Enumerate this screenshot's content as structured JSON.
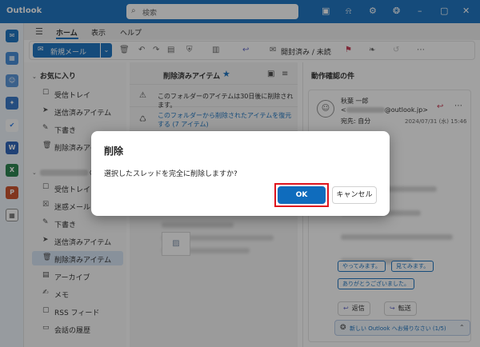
{
  "app": {
    "title": "Outlook"
  },
  "search": {
    "placeholder": "検索"
  },
  "titlebar_icons": [
    "whiteboard-icon",
    "bell-icon",
    "gear-icon",
    "lightbulb-icon",
    "minimize-icon",
    "maximize-icon",
    "close-icon"
  ],
  "menu": {
    "tabs": [
      "ホーム",
      "表示",
      "ヘルプ"
    ],
    "active": "ホーム"
  },
  "ribbon": {
    "new_mail": "新規メール",
    "read_unread": "開封済み / 未読"
  },
  "favorites": {
    "header": "お気に入り",
    "items": [
      "受信トレイ",
      "送信済みアイテム",
      "下書き",
      "削除済みアイテム"
    ]
  },
  "account": {
    "suffix": "@",
    "items": [
      "受信トレイ",
      "迷惑メール",
      "下書き",
      "送信済みアイテム",
      "削除済みアイテム",
      "アーカイブ",
      "メモ",
      "RSS フィード",
      "会話の履歴"
    ],
    "selected": "削除済みアイテム"
  },
  "message_list": {
    "title": "削除済みアイテム",
    "notice": "このフォルダーのアイテムは30日後に削除されます。",
    "restore_link": "このフォルダーから削除されたアイテムを復元する (7 アイテム)"
  },
  "reading_pane": {
    "title": "動作確認の件",
    "sender": "秋葉 一郎",
    "sender_domain": "@outlook.jp>",
    "recipient": "宛先: 自分",
    "date": "2024/07/31 (水) 15:46",
    "quick_replies": [
      "やってみます。",
      "見てみます。",
      "ありがとうございました。"
    ],
    "reply": "返信",
    "forward": "転送",
    "promo": "新しい Outlook へお帰りなさい (1/5)"
  },
  "dialog": {
    "title": "削除",
    "message": "選択したスレッドを完全に削除しますか?",
    "ok": "OK",
    "cancel": "キャンセル"
  },
  "colors": {
    "accent": "#0f6cbd",
    "highlight": "#e0141d"
  }
}
